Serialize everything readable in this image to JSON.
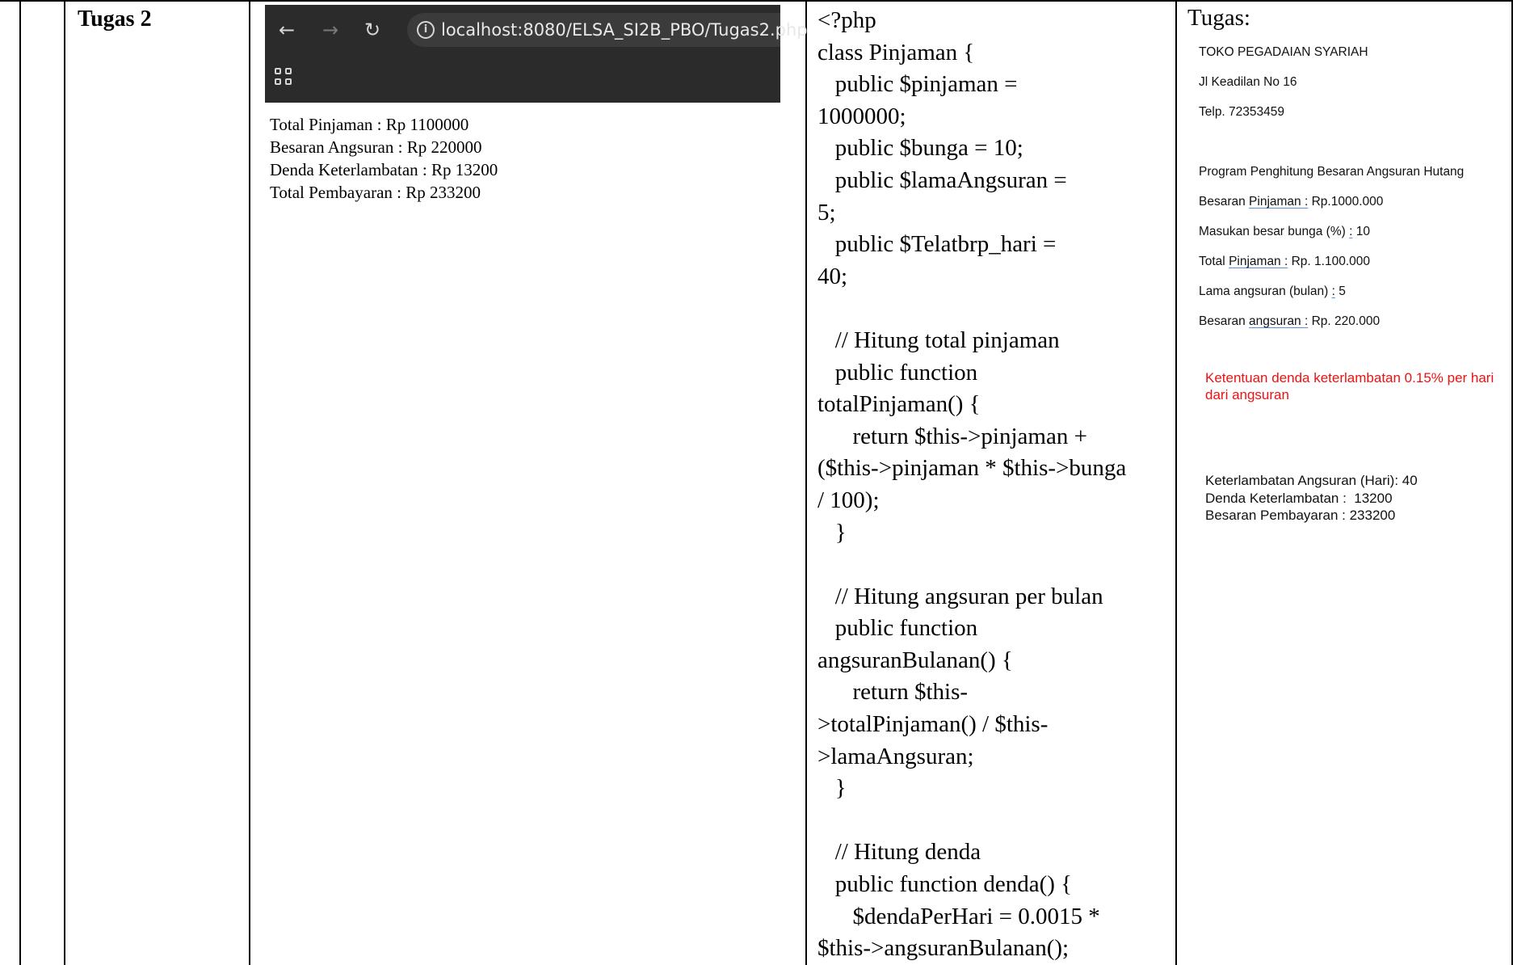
{
  "section": {
    "title": "Tugas 2"
  },
  "browser": {
    "url": "localhost:8080/ELSA_SI2B_PBO/Tugas2.php",
    "icons": [
      "back-arrow-icon",
      "forward-arrow-icon",
      "reload-icon",
      "info-icon",
      "apps-grid-icon"
    ]
  },
  "output": [
    "Total Pinjaman : Rp 1100000",
    "Besaran Angsuran : Rp 220000",
    "Denda Keterlambatan : Rp 13200",
    "Total Pembayaran : Rp 233200"
  ],
  "code": [
    "<?php",
    "class Pinjaman {",
    "   public $pinjaman =",
    "1000000;",
    "   public $bunga = 10;",
    "   public $lamaAngsuran =",
    "5;",
    "   public $Telatbrp_hari =",
    "40;",
    "",
    "   // Hitung total pinjaman",
    "   public function",
    "totalPinjaman() {",
    "      return $this->pinjaman +",
    "($this->pinjaman * $this->bunga",
    "/ 100);",
    "   }",
    "",
    "   // Hitung angsuran per bulan",
    "   public function",
    "angsuranBulanan() {",
    "      return $this-",
    ">totalPinjaman() / $this-",
    ">lamaAngsuran;",
    "   }",
    "",
    "   // Hitung denda",
    "   public function denda() {",
    "      $dendaPerHari = 0.0015 *",
    "$this->angsuranBulanan();"
  ],
  "task": {
    "heading": "Tugas:",
    "shop_name": "TOKO PEGADAIAN SYARIAH",
    "address": "Jl Keadilan No 16",
    "phone": "Telp. 72353459",
    "program_title": "Program Penghitung Besaran Angsuran Hutang",
    "lines": [
      {
        "pre": "Besaran ",
        "u": "Pinjaman :",
        "post": " Rp.1000.000"
      },
      {
        "pre": "Masukan besar bunga (%) ",
        "u": ":",
        "post": " 10"
      },
      {
        "pre": "Total ",
        "u": "Pinjaman :",
        "post": " Rp. 1.100.000"
      },
      {
        "pre": "Lama angsuran (bulan) ",
        "u": ":",
        "post": " 5"
      },
      {
        "pre": "Besaran ",
        "u": "angsuran :",
        "post": " Rp. 220.000"
      }
    ],
    "note": "Ketentuan denda keterlambatan 0.15% per hari dari angsuran",
    "note_color": "#ee1111",
    "stats": [
      "Keterlambatan Angsuran (Hari): 40",
      "Denda Keterlambatan :  13200",
      "Besaran Pembayaran : 233200"
    ]
  }
}
